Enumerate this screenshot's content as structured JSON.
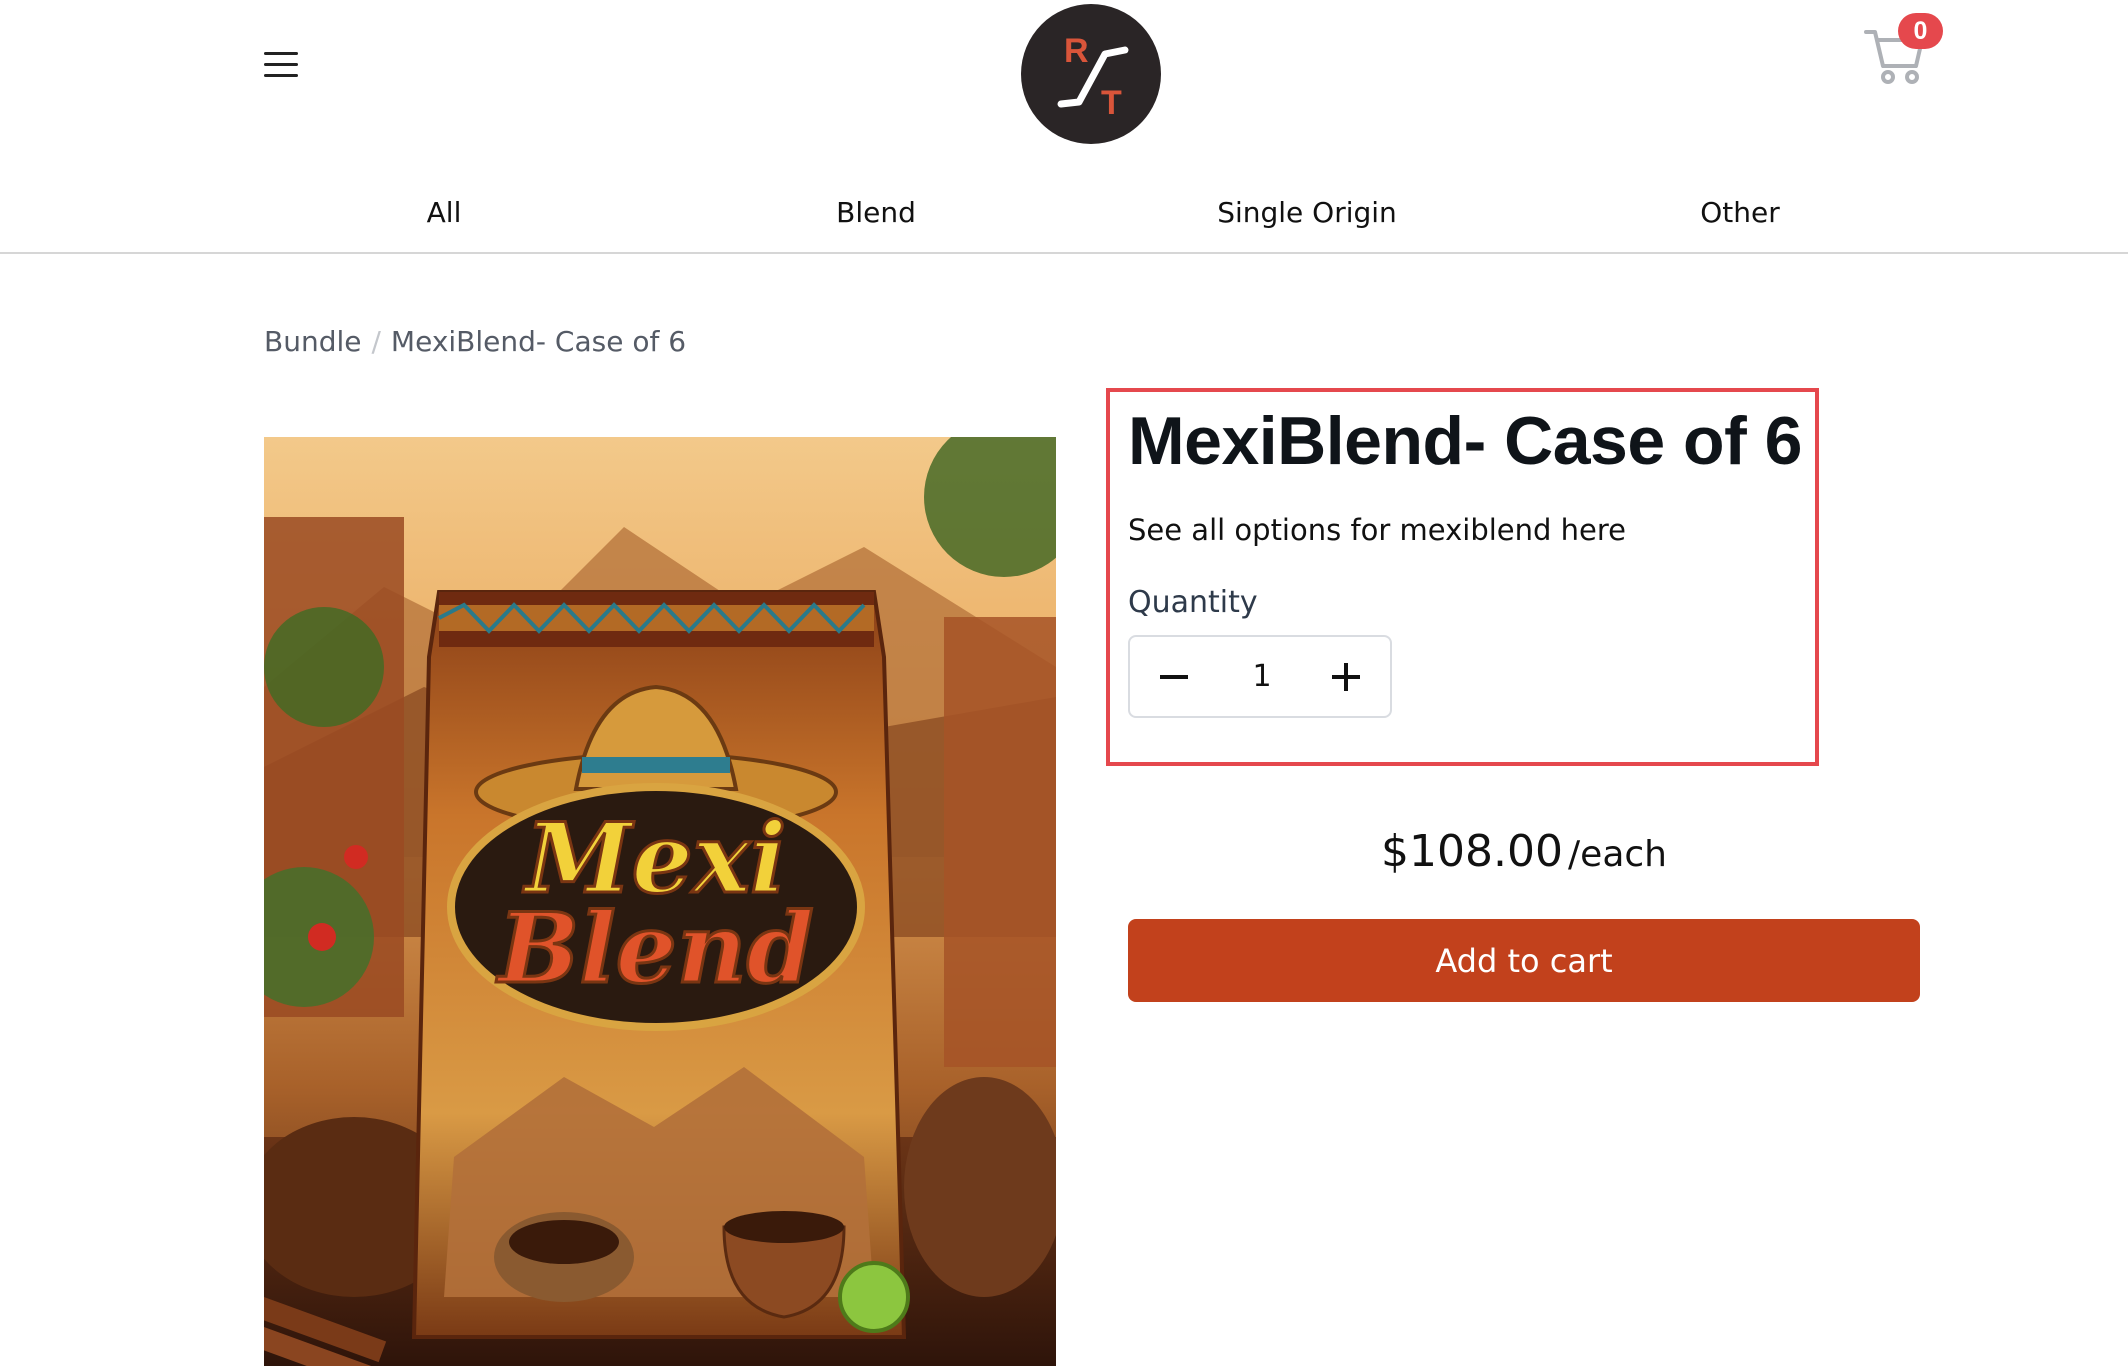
{
  "header": {
    "logo": {
      "letters": [
        "R",
        "T"
      ]
    },
    "cart": {
      "count": "0"
    }
  },
  "nav": {
    "items": [
      {
        "label": "All"
      },
      {
        "label": "Blend"
      },
      {
        "label": "Single Origin"
      },
      {
        "label": "Other"
      }
    ]
  },
  "breadcrumb": {
    "items": [
      "Bundle",
      "MexiBlend- Case of 6"
    ],
    "separator": "/"
  },
  "product": {
    "title": "MexiBlend- Case of 6",
    "options_link": "See all options for mexiblend here",
    "quantity_label": "Quantity",
    "quantity": "1",
    "price": "$108.00",
    "price_unit": "/each",
    "add_to_cart_label": "Add to cart",
    "image": {
      "brand_line1": "Mexi",
      "brand_line2": "Blend"
    }
  },
  "colors": {
    "accent": "#c2411c",
    "highlight": "#e5484d",
    "badge": "#e5484d",
    "logo_bg": "#2a2526",
    "logo_letters": "#d9553a"
  }
}
